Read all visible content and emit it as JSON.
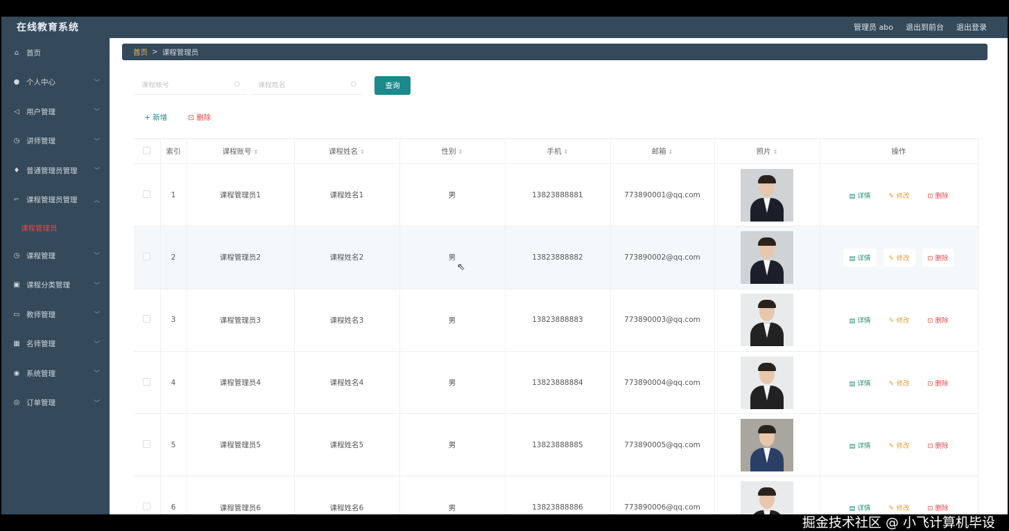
{
  "app": {
    "title": "在线教育系统"
  },
  "topnav": {
    "user": "管理员 abo",
    "front": "退出到前台",
    "logout": "退出登录"
  },
  "sidebar": {
    "items": [
      {
        "label": "首页",
        "icon": "home-icon",
        "glyph": "⌂",
        "chevron": false
      },
      {
        "label": "个人中心",
        "icon": "user-icon",
        "glyph": "●",
        "chevron": true
      },
      {
        "label": "用户管理",
        "icon": "send-icon",
        "glyph": "◁",
        "chevron": true
      },
      {
        "label": "讲师管理",
        "icon": "clock-icon",
        "glyph": "◷",
        "chevron": true
      },
      {
        "label": "普通管理员管理",
        "icon": "mic-icon",
        "glyph": "♦",
        "chevron": true
      },
      {
        "label": "课程管理员管理",
        "icon": "crop-icon",
        "glyph": "⌐",
        "chevron": true,
        "expanded": true
      }
    ],
    "subitem": "课程管理员",
    "items2": [
      {
        "label": "课程管理",
        "icon": "clock-icon",
        "glyph": "◷"
      },
      {
        "label": "课程分类管理",
        "icon": "clipboard-icon",
        "glyph": "▣"
      },
      {
        "label": "教师管理",
        "icon": "monitor-icon",
        "glyph": "▭"
      },
      {
        "label": "名师管理",
        "icon": "table-icon",
        "glyph": "▦"
      },
      {
        "label": "系统管理",
        "icon": "location-icon",
        "glyph": "◉"
      },
      {
        "label": "订单管理",
        "icon": "basketball-icon",
        "glyph": "◎"
      }
    ]
  },
  "breadcrumb": {
    "home": "首页",
    "sep": ">",
    "current": "课程管理员"
  },
  "search": {
    "account_placeholder": "课程账号",
    "name_placeholder": "课程姓名",
    "query_label": "查询"
  },
  "actions": {
    "add": "+ 新增",
    "delete": "删除"
  },
  "table": {
    "headers": [
      "索引",
      "课程账号",
      "课程姓名",
      "性别",
      "手机",
      "邮箱",
      "照片",
      "操作"
    ],
    "sort_glyph": "⇕",
    "ops": {
      "detail": "详情",
      "edit": "修改",
      "delete": "删除"
    },
    "rows": [
      {
        "index": "1",
        "account": "课程管理员1",
        "name": "课程姓名1",
        "gender": "男",
        "phone": "13823888881",
        "email": "773890001@qq.com",
        "photo": "male"
      },
      {
        "index": "2",
        "account": "课程管理员2",
        "name": "课程姓名2",
        "gender": "男",
        "phone": "13823888882",
        "email": "773890002@qq.com",
        "photo": "male"
      },
      {
        "index": "3",
        "account": "课程管理员3",
        "name": "课程姓名3",
        "gender": "男",
        "phone": "13823888883",
        "email": "773890003@qq.com",
        "photo": "female"
      },
      {
        "index": "4",
        "account": "课程管理员4",
        "name": "课程姓名4",
        "gender": "男",
        "phone": "13823888884",
        "email": "773890004@qq.com",
        "photo": "female"
      },
      {
        "index": "5",
        "account": "课程管理员5",
        "name": "课程姓名5",
        "gender": "男",
        "phone": "13823888885",
        "email": "773890005@qq.com",
        "photo": "male-casual"
      },
      {
        "index": "6",
        "account": "课程管理员6",
        "name": "课程姓名6",
        "gender": "男",
        "phone": "13823888886",
        "email": "773890006@qq.com",
        "photo": "female"
      }
    ]
  },
  "watermark": "掘金技术社区 @ 小飞计算机毕设",
  "colors": {
    "sidebar": "#34495a",
    "accent": "#1b8a8a",
    "danger": "#e24a4a",
    "warning": "#e6a23c"
  }
}
